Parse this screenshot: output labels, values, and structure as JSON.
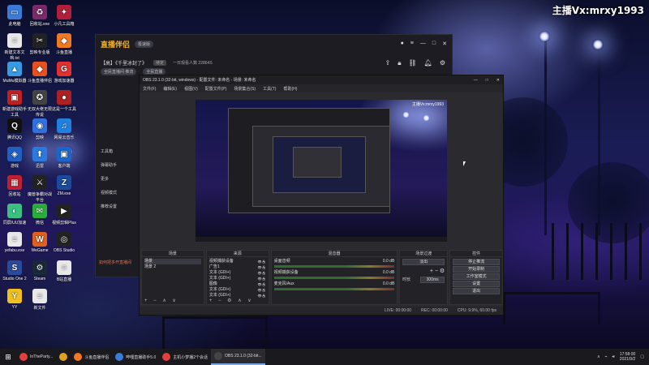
{
  "watermark": "主播Vx:mrxy1993",
  "desktop_icons": [
    {
      "label": "此电脑",
      "color": "#3b7bd8",
      "glyph": "▭"
    },
    {
      "label": "回收站.exe",
      "color": "#7a2a6a",
      "glyph": "♻"
    },
    {
      "label": "小凡工具箱",
      "color": "#b0203a",
      "glyph": "✦"
    },
    {
      "label": "新建文本文档.txt",
      "color": "#e8e8e8",
      "glyph": "≡"
    },
    {
      "label": "剪映专业版",
      "color": "#222",
      "glyph": "✂"
    },
    {
      "label": "斗鱼直播",
      "color": "#f07820",
      "glyph": "◆"
    },
    {
      "label": "MuMu模拟器",
      "color": "#3a9ae0",
      "glyph": "▲"
    },
    {
      "label": "斗鱼直播伴侣",
      "color": "#e85020",
      "glyph": "◆"
    },
    {
      "label": "游戏加速器",
      "color": "#e03030",
      "glyph": "G"
    },
    {
      "label": "新建游戏助手工具",
      "color": "#c02020",
      "glyph": "▣"
    },
    {
      "label": "无双大佬无限传说",
      "color": "#444",
      "glyph": "✪"
    },
    {
      "label": "这是一个工具",
      "color": "#aa2222",
      "glyph": "●"
    },
    {
      "label": "腾讯QQ",
      "color": "#111",
      "glyph": "Q"
    },
    {
      "label": "剪映",
      "color": "#3070e0",
      "glyph": "◉"
    },
    {
      "label": "网易云音乐",
      "color": "#2080e0",
      "glyph": "♫"
    },
    {
      "label": "游戏",
      "color": "#2060c0",
      "glyph": "◈"
    },
    {
      "label": "迅雷",
      "color": "#2a7ae0",
      "glyph": "⬆"
    },
    {
      "label": "客户端",
      "color": "#1a66cc",
      "glyph": "▣"
    },
    {
      "label": "回收站",
      "color": "#c02030",
      "glyph": "▦"
    },
    {
      "label": "魔兽争霸对战平台",
      "color": "#222",
      "glyph": "⚔"
    },
    {
      "label": "ZM.exe",
      "color": "#1a4a9a",
      "glyph": "Z"
    },
    {
      "label": "同屏/UU加速",
      "color": "#3ac080",
      "glyph": "◐"
    },
    {
      "label": "微信",
      "color": "#2aae3a",
      "glyph": "✉"
    },
    {
      "label": "视频剪辑Plus",
      "color": "#222",
      "glyph": "▶"
    },
    {
      "label": "yefabu.exe",
      "color": "#e8e8e8",
      "glyph": "≡"
    },
    {
      "label": "WeGame",
      "color": "#e06020",
      "glyph": "W"
    },
    {
      "label": "OBS Studio",
      "color": "#222",
      "glyph": "◎"
    },
    {
      "label": "Studio One 2",
      "color": "#2a4a9a",
      "glyph": "S"
    },
    {
      "label": "Steam",
      "color": "#1b2838",
      "glyph": "⚙"
    },
    {
      "label": "B站直播",
      "color": "#e8e8e8",
      "glyph": "≡"
    },
    {
      "label": "YY",
      "color": "#f0c020",
      "glyph": "Y"
    },
    {
      "label": "新文件",
      "color": "#e8e8e8",
      "glyph": "≡"
    }
  ],
  "livestream_app": {
    "logo": "直播伴侣",
    "version_chip": "极速版",
    "room_title": "【高】《千里冰封了》",
    "room_tag": "待定",
    "sub_links": [
      "全民直播间 推流",
      "全民直播"
    ],
    "viewer_info": "一日观看人数 22864S",
    "side_items": [
      "工具箱",
      "弹幕助手",
      "更多",
      "视频模式",
      "推荐设置"
    ],
    "footer_text": "如何把多开直播间"
  },
  "obs": {
    "title": "OBS 23.1.0 (32-bit, windows) - 配置文件: 未命名 - 场景: 未命名",
    "menu": [
      "文件(F)",
      "编辑(E)",
      "视图(V)",
      "配置文件(P)",
      "场景集合(S)",
      "工具(T)",
      "帮助(H)"
    ],
    "preview_watermark": "主播Vx:mrxy1993",
    "docks": {
      "scenes": {
        "header": "场景",
        "items": [
          "场景",
          "场景 2"
        ],
        "footer": "+ − ∧ ∨"
      },
      "sources": {
        "header": "来源",
        "items": [
          "视频捕获设备",
          "广告1",
          "文本 (GDI+)",
          "文本 (GDI+)",
          "图像",
          "文本 (GDI+)",
          "文本 (GDI+)"
        ],
        "footer": "+ − ⚙ ∧ ∨"
      },
      "mixer": {
        "header": "混音器",
        "channels": [
          {
            "name": "桌面音频",
            "db": "0.0 dB"
          },
          {
            "name": "视频捕获设备",
            "db": "0.0 dB"
          },
          {
            "name": "麦克风/Aux",
            "db": "0.0 dB"
          }
        ]
      },
      "transitions": {
        "header": "场景过渡",
        "type": "淡出",
        "duration_label": "时长",
        "duration_value": "300ms"
      },
      "controls": {
        "header": "控件",
        "buttons": [
          "停止推流",
          "开始录制",
          "工作室模式",
          "设置",
          "退出"
        ]
      }
    },
    "status": {
      "live": "LIVE: 00:00:00",
      "rec": "REC: 00:00:00",
      "cpu": "CPU: 9.9%, 60.00 fps"
    }
  },
  "taskbar": {
    "items": [
      {
        "label": "InTheParty...",
        "color": "#e04040",
        "active": false
      },
      {
        "label": "",
        "color": "#e0a020",
        "active": false
      },
      {
        "label": "斗鱼直播伴侣",
        "color": "#f07820",
        "active": false
      },
      {
        "label": "哔哩直播助手5.0",
        "color": "#3a7ad8",
        "active": false
      },
      {
        "label": "主机小梦播2个会话",
        "color": "#e04040",
        "active": false
      },
      {
        "label": "OBS 23.1.0 (32-bit...",
        "color": "#444",
        "active": true
      }
    ],
    "time": "17:58:00",
    "date": "2021/9/2"
  }
}
